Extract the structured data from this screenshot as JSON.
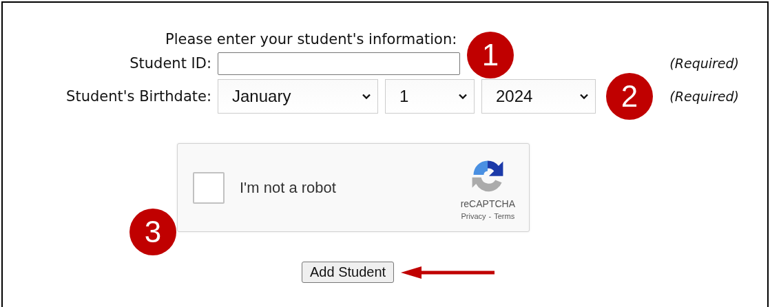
{
  "heading": "Please enter your student's information:",
  "fields": [
    {
      "kind": "text",
      "label": "Student ID:",
      "note": "(Required)",
      "callout": "1"
    },
    {
      "kind": "date",
      "label": "Student's Birthdate:",
      "selects": [
        "January",
        "1",
        "2024"
      ],
      "note": "(Required)",
      "callout": "2"
    }
  ],
  "captcha": {
    "checked": false,
    "label": "I'm not a robot",
    "brand": "reCAPTCHA",
    "links": [
      "Privacy",
      "Terms"
    ],
    "separator": "-",
    "callout": "3"
  },
  "submit": {
    "label": "Add Student"
  }
}
